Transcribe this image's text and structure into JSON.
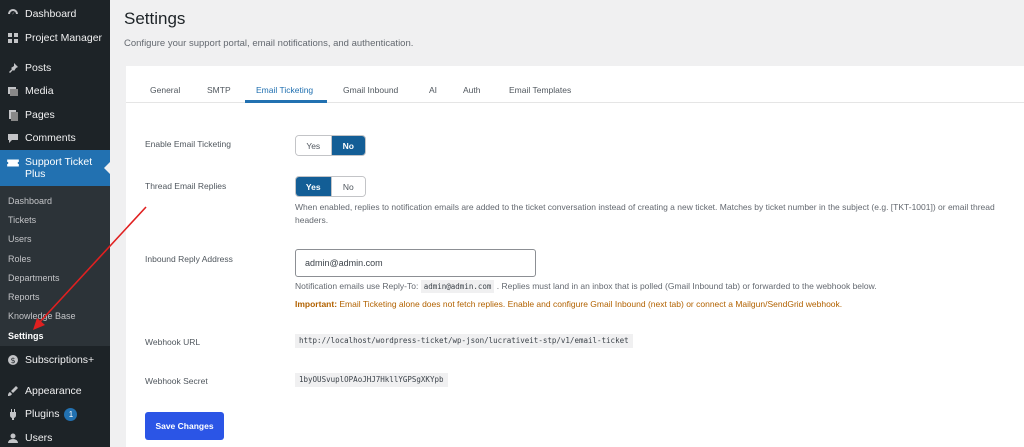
{
  "sidebar": {
    "items": [
      {
        "label": "Dashboard",
        "icon": "dashboard-icon"
      },
      {
        "label": "Project Manager",
        "icon": "grid-icon"
      },
      {
        "label": "Posts",
        "icon": "pin-icon"
      },
      {
        "label": "Media",
        "icon": "media-icon"
      },
      {
        "label": "Pages",
        "icon": "pages-icon"
      },
      {
        "label": "Comments",
        "icon": "comment-icon"
      }
    ],
    "active": {
      "label": "Support Ticket Plus",
      "icon": "ticket-icon"
    },
    "submenu": [
      "Dashboard",
      "Tickets",
      "Users",
      "Roles",
      "Departments",
      "Reports",
      "Knowledge Base",
      "Settings"
    ],
    "bottom_items": [
      {
        "label": "Subscriptions+",
        "icon": "dollar-icon"
      },
      {
        "label": "Appearance",
        "icon": "brush-icon"
      },
      {
        "label": "Plugins",
        "icon": "plugin-icon",
        "badge": "1"
      },
      {
        "label": "Users",
        "icon": "user-icon"
      }
    ]
  },
  "header": {
    "title": "Settings",
    "description": "Configure your support portal, email notifications, and authentication."
  },
  "tabs": [
    "General",
    "SMTP",
    "Email Ticketing",
    "Gmail Inbound",
    "AI",
    "Auth",
    "Email Templates"
  ],
  "active_tab": "Email Ticketing",
  "form": {
    "enable": {
      "label": "Enable Email Ticketing",
      "yes": "Yes",
      "no": "No",
      "selected": "No"
    },
    "thread": {
      "label": "Thread Email Replies",
      "yes": "Yes",
      "no": "No",
      "selected": "Yes",
      "help": "When enabled, replies to notification emails are added to the ticket conversation instead of creating a new ticket. Matches by ticket number in the subject (e.g. [TKT-1001]) or email thread headers."
    },
    "inbound": {
      "label": "Inbound Reply Address",
      "value": "admin@admin.com",
      "help_prefix": "Notification emails use Reply-To:",
      "help_code": "admin@admin.com",
      "help_suffix": ". Replies must land in an inbox that is polled (Gmail Inbound tab) or forwarded to the webhook below.",
      "warning_bold": "Important:",
      "warning_text": " Email Ticketing alone does not fetch replies. Enable and configure Gmail Inbound (next tab) or connect a Mailgun/SendGrid webhook."
    },
    "webhook_url": {
      "label": "Webhook URL",
      "value": "http://localhost/wordpress-ticket/wp-json/lucrativeit-stp/v1/email-ticket"
    },
    "webhook_secret": {
      "label": "Webhook Secret",
      "value": "1byOUSvuplOPAoJHJ7HkllYGPSgXKYpb"
    },
    "save_label": "Save Changes"
  },
  "colors": {
    "accent": "#2271b1",
    "button": "#2b55e6",
    "sidebar": "#1d2327",
    "warning": "#b26200",
    "annotation": "#e02020"
  }
}
